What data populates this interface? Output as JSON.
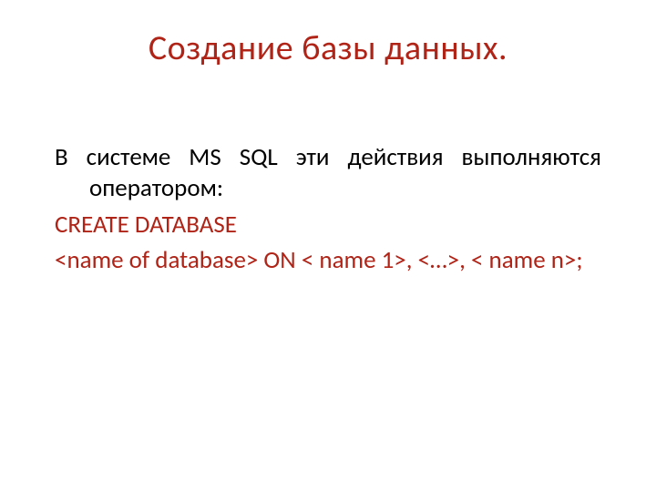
{
  "colors": {
    "accent": "#b02418"
  },
  "title": "Создание базы данных.",
  "body": {
    "line1": "В системе MS SQL  эти действия выполняются оператором:",
    "line2": "CREATE DATABASE",
    "line3": "<name of database> ON < name 1>, <…>, < name n>;"
  }
}
